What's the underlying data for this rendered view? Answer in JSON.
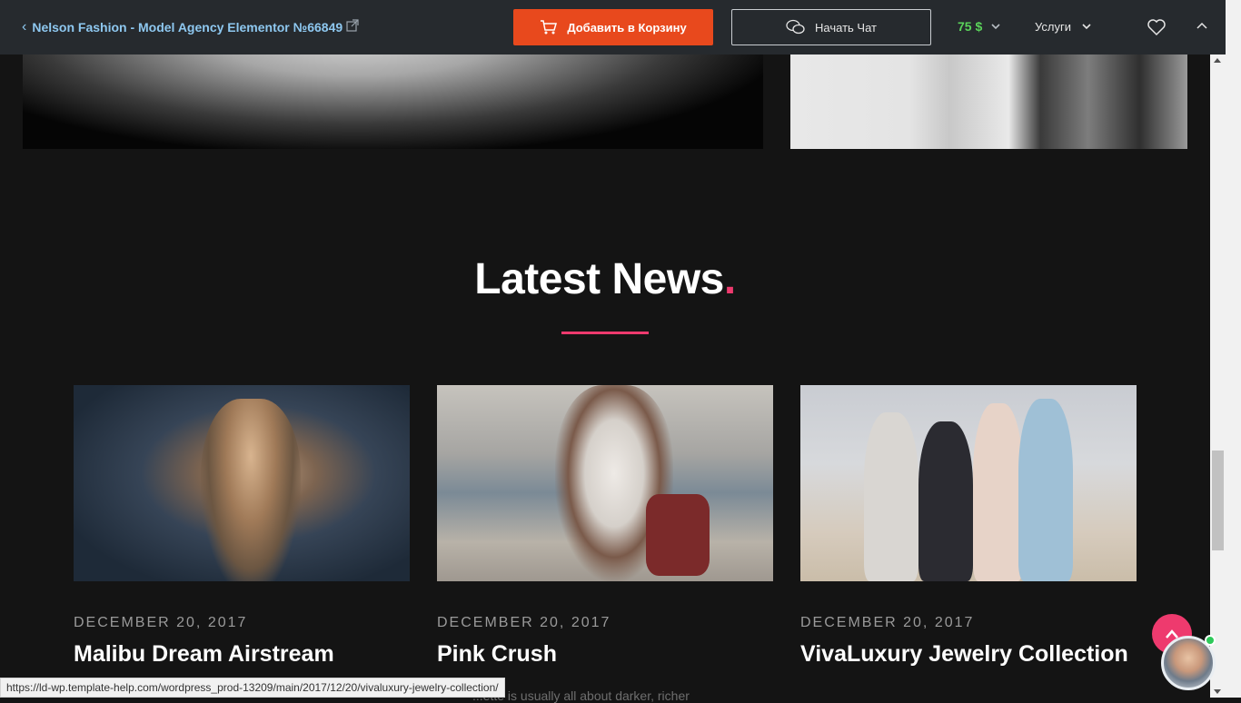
{
  "topbar": {
    "back_label": "Nelson Fashion - Model Agency Elementor №66849",
    "cart_button": "Добавить в Корзину",
    "chat_button": "Начать Чат",
    "price": "75 $",
    "services": "Услуги",
    "colors": {
      "bar": "#262a2e",
      "cart": "#e8491d",
      "price": "#5ad35a",
      "link": "#8ec8f0"
    }
  },
  "news": {
    "title": "Latest News",
    "title_dot": ".",
    "accent": "#ee3a6e",
    "cards": [
      {
        "date": "DECEMBER 20, 2017",
        "title": "Malibu Dream Airstream",
        "excerpt": ""
      },
      {
        "date": "DECEMBER 20, 2017",
        "title": "Pink Crush",
        "excerpt": "...ette is usually all about darker, richer"
      },
      {
        "date": "DECEMBER 20, 2017",
        "title": "VivaLuxury Jewelry Collection",
        "excerpt": ""
      }
    ]
  },
  "status_bar": {
    "url": "https://ld-wp.template-help.com/wordpress_prod-13209/main/2017/12/20/vivaluxury-jewelry-collection/"
  },
  "widgets": {
    "to_top_icon": "arrow-up-icon",
    "chat_avatar": "support-agent-avatar"
  }
}
